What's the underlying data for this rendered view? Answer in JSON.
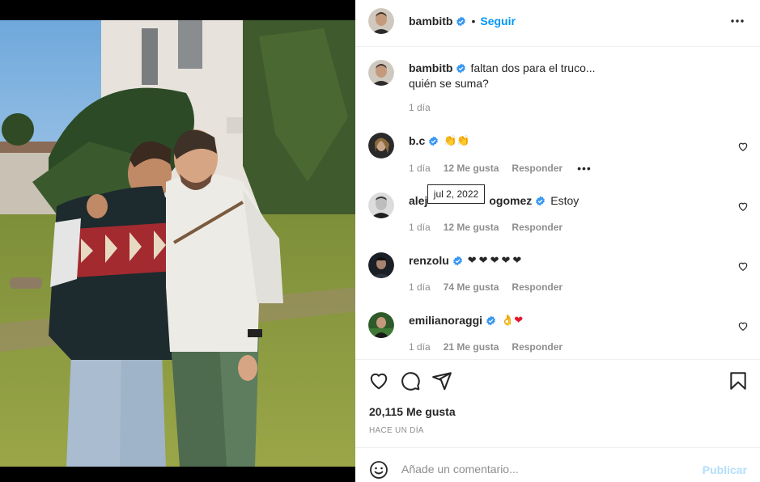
{
  "post": {
    "author": "bambitb",
    "follow_label": "Seguir",
    "dot_separator": "•",
    "caption_line1": "faltan dos para el truco...",
    "caption_line2": "quién se suma?",
    "caption_time": "1 día"
  },
  "comments": [
    {
      "user": "b.c",
      "text": "👏👏",
      "time": "1 día",
      "likes": "12 Me gusta",
      "reply": "Responder",
      "more": "•••"
    },
    {
      "user_prefix": "alej",
      "user_suffix": "ogomez",
      "text": "Estoy",
      "time": "1 día",
      "likes": "12 Me gusta",
      "reply": "Responder"
    },
    {
      "user": "renzolu",
      "text": "❤❤❤❤❤",
      "time": "1 día",
      "likes": "74 Me gusta",
      "reply": "Responder"
    },
    {
      "user": "emilianoraggi",
      "text_a": "👌",
      "text_b": "❤",
      "time": "1 día",
      "likes": "21 Me gusta",
      "reply": "Responder"
    }
  ],
  "tooltip": "jul 2, 2022",
  "stats": {
    "likes": "20,115 Me gusta",
    "age": "HACE UN DÍA"
  },
  "composer": {
    "placeholder": "Añade un comentario...",
    "publish_label": "Publicar"
  },
  "icons": {
    "verified": "verified-badge-icon",
    "more": "more-options-icon",
    "like": "heart-icon",
    "comment": "comment-icon",
    "share": "share-icon",
    "save": "bookmark-icon",
    "emoji": "emoji-icon"
  },
  "colors": {
    "accent": "#0095f6",
    "publish_disabled": "#b2dffc",
    "secondary_text": "#8e8e8e",
    "verified": "#3897f0",
    "heart": "#e0182d"
  }
}
